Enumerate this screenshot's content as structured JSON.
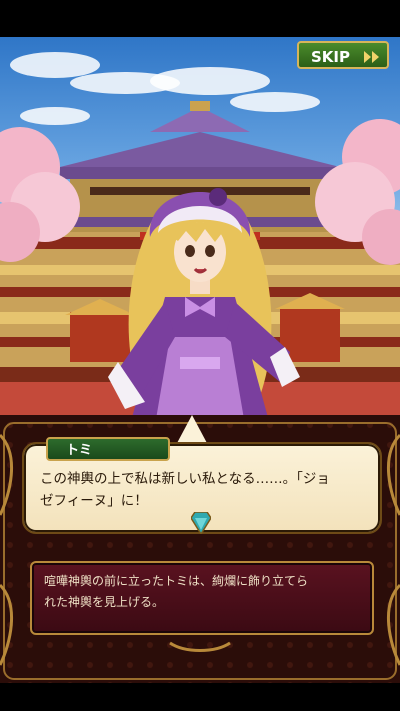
{
  "skip": {
    "label": "SKIP"
  },
  "dialogue": {
    "speaker": "トミ",
    "line1": "この神輿の上で私は新しい私となる……。「ジョ",
    "line2": "ゼフィーヌ」に！"
  },
  "narration": {
    "line1": "喧嘩神輿の前に立ったトミは、絢爛に飾り立てら",
    "line2": "れた神輿を見上げる。"
  },
  "colors": {
    "sky": "#6aa6e2",
    "dress": "#7a3f9e",
    "hair": "#e8c35a",
    "skip": "#3c7a22",
    "narration": "#4a0f1a"
  }
}
